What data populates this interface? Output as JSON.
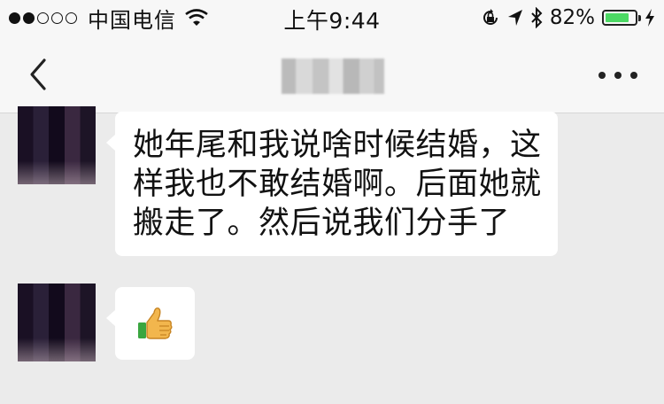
{
  "status_bar": {
    "signal_filled": 2,
    "signal_total": 5,
    "carrier": "中国电信",
    "time": "上午9:44",
    "battery": "82%",
    "battery_level": 0.82,
    "icons": [
      "wifi-icon",
      "orientation-lock-icon",
      "location-arrow-icon",
      "bluetooth-icon",
      "battery-icon",
      "charging-bolt-icon"
    ]
  },
  "nav": {
    "back_icon": "chevron-left-icon",
    "more_icon": "more-dots-icon"
  },
  "messages": [
    {
      "text": "她年尾和我说啥时候结婚，这样我也不敢结婚啊。后面她就搬走了。然后说我们分手了"
    },
    {
      "emoji": "thumbs-up-icon"
    }
  ],
  "colors": {
    "background": "#ebebeb",
    "bar": "#f7f7f7",
    "bubble": "#ffffff",
    "battery_green": "#4cd964"
  }
}
